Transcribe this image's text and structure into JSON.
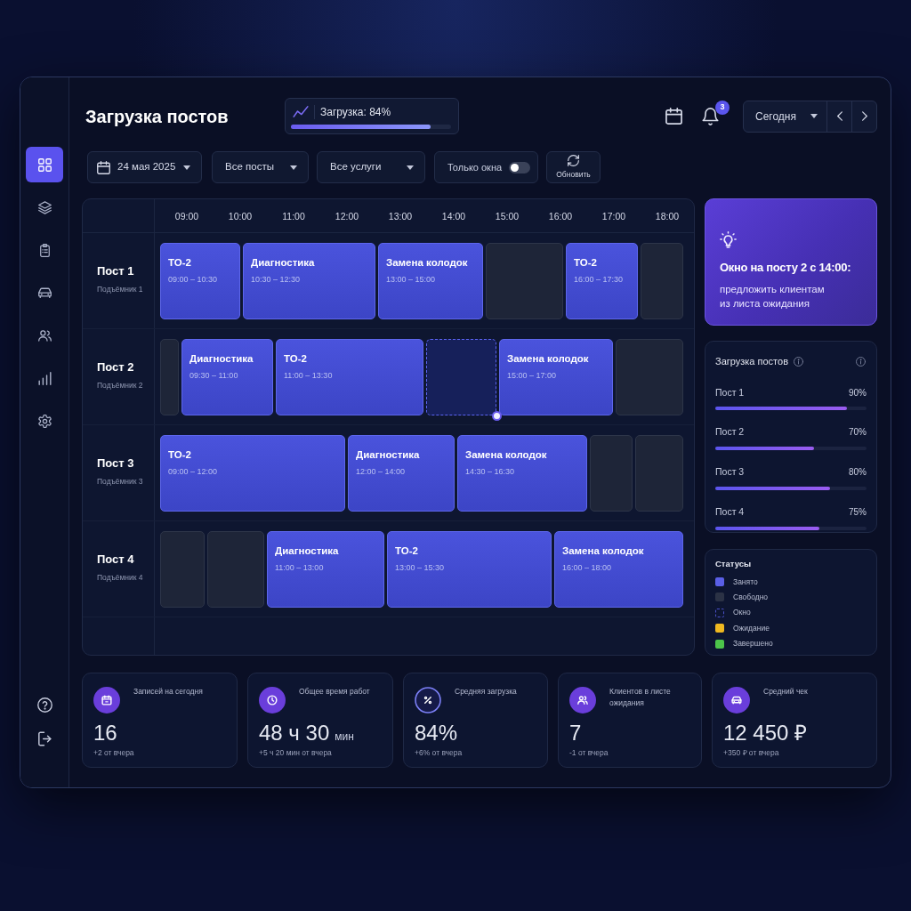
{
  "header": {
    "title": "Загрузка постов",
    "load_summary": {
      "label": "Загрузка: 84%",
      "level": 0.87
    },
    "notifications": {
      "count": "3"
    },
    "period": {
      "value": "Сегодня"
    }
  },
  "sidebar": {
    "items": [
      {
        "selected": true
      },
      {
        "selected": false
      },
      {
        "selected": false
      },
      {
        "selected": false
      },
      {
        "selected": false
      },
      {
        "selected": false
      },
      {
        "selected": false
      }
    ]
  },
  "filters": [
    {
      "kind": "date",
      "value": "24 мая 2025"
    },
    {
      "kind": "select",
      "value": "Все посты"
    },
    {
      "kind": "select",
      "value": "Все услуги"
    },
    {
      "kind": "toggle",
      "label": "Только окна",
      "on": false
    },
    {
      "kind": "button",
      "label": "Обновить"
    }
  ],
  "schedule": {
    "hours": [
      "09:00",
      "10:00",
      "11:00",
      "12:00",
      "13:00",
      "14:00",
      "15:00",
      "16:00",
      "17:00",
      "18:00"
    ],
    "rows": [
      {
        "name": "Пост 1",
        "lift": "Подъёмник 1",
        "slots": [
          {
            "kind": "busy",
            "service": "ТО-2",
            "time": "09:00 – 10:30"
          },
          {
            "kind": "busy",
            "service": "Диагностика",
            "time": "10:30 – 12:30"
          },
          {
            "kind": "busy",
            "service": "Замена колодок",
            "time": "13:00 – 15:00"
          },
          {
            "kind": "free"
          },
          {
            "kind": "busy",
            "service": "ТО-2",
            "time": "16:00 – 17:30"
          },
          {
            "kind": "free"
          }
        ]
      },
      {
        "name": "Пост 2",
        "lift": "Подъёмник 2",
        "slots": [
          {
            "kind": "free"
          },
          {
            "kind": "busy",
            "service": "Диагностика",
            "time": "09:30 – 11:00"
          },
          {
            "kind": "busy",
            "service": "ТО-2",
            "time": "11:00 – 13:30"
          },
          {
            "kind": "window"
          },
          {
            "kind": "busy",
            "service": "Замена колодок",
            "time": "15:00 – 17:00"
          },
          {
            "kind": "free"
          }
        ]
      },
      {
        "name": "Пост 3",
        "lift": "Подъёмник 3",
        "slots": [
          {
            "kind": "busy",
            "service": "ТО-2",
            "time": "09:00 – 12:00"
          },
          {
            "kind": "busy",
            "service": "Диагностика",
            "time": "12:00 – 14:00"
          },
          {
            "kind": "busy",
            "service": "Замена колодок",
            "time": "14:30 – 16:30"
          },
          {
            "kind": "free"
          },
          {
            "kind": "free"
          }
        ]
      },
      {
        "name": "Пост 4",
        "lift": "Подъёмник 4",
        "slots": [
          {
            "kind": "free"
          },
          {
            "kind": "free"
          },
          {
            "kind": "busy",
            "service": "Диагностика",
            "time": "11:00 – 13:00"
          },
          {
            "kind": "busy",
            "service": "ТО-2",
            "time": "13:00 – 15:30"
          },
          {
            "kind": "busy",
            "service": "Замена колодок",
            "time": "16:00 – 18:00"
          }
        ]
      }
    ]
  },
  "tip": {
    "title": "Окно на посту 2 с 14:00:",
    "text": "предложить клиентам\nиз листа ожидания"
  },
  "post_load": {
    "title": "Загрузка постов",
    "rows": [
      {
        "name": "Пост 1",
        "value": "90%",
        "level": 0.87
      },
      {
        "name": "Пост 2",
        "value": "70%",
        "level": 0.65
      },
      {
        "name": "Пост 3",
        "value": "80%",
        "level": 0.76
      },
      {
        "name": "Пост 4",
        "value": "75%",
        "level": 0.69
      }
    ]
  },
  "legend": {
    "title": "Статусы",
    "items": [
      {
        "label": "Занято",
        "color": "#5a5fe6",
        "kind": "solid"
      },
      {
        "label": "Свободно",
        "color": "#2b3245",
        "kind": "solid"
      },
      {
        "label": "Окно",
        "color": "#4a50c8",
        "kind": "dashed"
      },
      {
        "label": "Ожидание",
        "color": "#efb820",
        "kind": "solid"
      },
      {
        "label": "Завершено",
        "color": "#4cc44a",
        "kind": "solid"
      }
    ]
  },
  "stats": [
    {
      "label": "Записей на сегодня",
      "value": "16",
      "change": "+2 от вчера"
    },
    {
      "label": "Общее время работ",
      "value": "48 ч 30",
      "unit": "мин",
      "change": "+5 ч 20 мин от вчера"
    },
    {
      "label": "Средняя загрузка",
      "value": "84%",
      "change": "+6% от вчера"
    },
    {
      "label": "Клиентов в листе ожидания",
      "value": "7",
      "change": "-1 от вчера"
    },
    {
      "label": "Средний чек",
      "value": "12 450 ₽",
      "change": "+350 ₽ от вчера"
    }
  ]
}
